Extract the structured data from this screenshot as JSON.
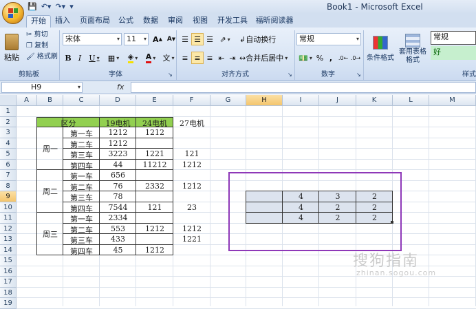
{
  "window": {
    "title": "Book1 - Microsoft Excel"
  },
  "tabs": [
    {
      "label": "开始",
      "active": true
    },
    {
      "label": "插入"
    },
    {
      "label": "页面布局"
    },
    {
      "label": "公式"
    },
    {
      "label": "数据"
    },
    {
      "label": "审阅"
    },
    {
      "label": "视图"
    },
    {
      "label": "开发工具"
    },
    {
      "label": "福昕阅读器"
    }
  ],
  "ribbon": {
    "clipboard": {
      "paste": "粘贴",
      "cut": "剪切",
      "copy": "复制",
      "painter": "格式刷",
      "label": "剪贴板"
    },
    "font": {
      "name": "宋体",
      "size": "11",
      "label": "字体",
      "bold": "B",
      "italic": "I",
      "underline": "U"
    },
    "alignment": {
      "wrap": "自动换行",
      "merge": "合并后居中",
      "label": "对齐方式"
    },
    "number": {
      "format": "常规",
      "label": "数字",
      "percent": "%"
    },
    "styles": {
      "conditional": "条件格式",
      "table": "套用表格格式",
      "label": "样式",
      "normal": "常规",
      "good": "好"
    }
  },
  "formula_bar": {
    "name_box": "H9",
    "fx": "fx",
    "value": ""
  },
  "columns": [
    "A",
    "B",
    "C",
    "D",
    "E",
    "F",
    "G",
    "H",
    "I",
    "J",
    "K",
    "L",
    "M"
  ],
  "rows": [
    "1",
    "2",
    "3",
    "4",
    "5",
    "6",
    "7",
    "8",
    "9",
    "10",
    "11",
    "12",
    "13",
    "14",
    "15",
    "16",
    "17",
    "18",
    "19"
  ],
  "sheet": {
    "header": {
      "category": "区分",
      "c1": "19电机",
      "c2": "24电机",
      "c3": "27电机"
    },
    "groups": [
      {
        "label": "周一"
      },
      {
        "label": "周二"
      },
      {
        "label": "周三"
      }
    ],
    "cars": [
      "第一车",
      "第二车",
      "第三车",
      "第四车",
      "第一车",
      "第二车",
      "第三车",
      "第四车",
      "第一车",
      "第二车",
      "第三车",
      "第四车"
    ],
    "d": [
      "1212",
      "1212",
      "3223",
      "44",
      "656",
      "76",
      "78",
      "7544",
      "2334",
      "553",
      "433",
      "45"
    ],
    "e": [
      "1212",
      "",
      "1221",
      "11212",
      "",
      "2332",
      "",
      "121",
      "",
      "1212",
      "",
      "1212"
    ],
    "f": [
      "",
      "",
      "121",
      "1212",
      "",
      "1212",
      "",
      "23",
      "",
      "1212",
      "1221",
      ""
    ],
    "selection": [
      [
        "4",
        "3",
        "2"
      ],
      [
        "4",
        "2",
        "2"
      ],
      [
        "4",
        "2",
        "2"
      ]
    ]
  },
  "watermark": {
    "text": "搜狗指南",
    "sub": "zhinan.sogou.com"
  }
}
